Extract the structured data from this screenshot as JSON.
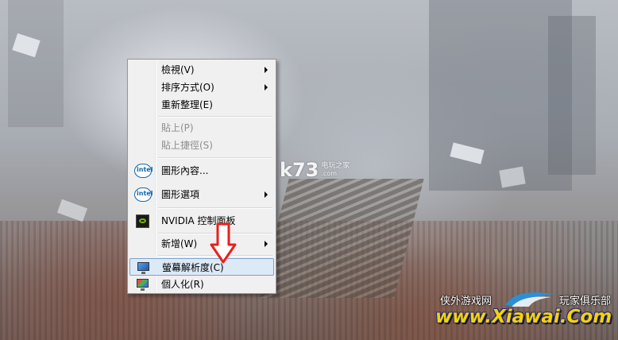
{
  "context_menu": {
    "items": [
      {
        "label": "檢視(V)",
        "submenu": true
      },
      {
        "label": "排序方式(O)",
        "submenu": true
      },
      {
        "label": "重新整理(E)"
      },
      {
        "label": "貼上(P)",
        "disabled": true
      },
      {
        "label": "貼上捷徑(S)",
        "disabled": true
      },
      {
        "label": "圖形內容...",
        "icon": "intel-icon"
      },
      {
        "label": "圖形選項",
        "icon": "intel-icon",
        "submenu": true
      },
      {
        "label": "NVIDIA 控制面板",
        "icon": "nvidia-icon"
      },
      {
        "label": "新增(W)",
        "submenu": true
      },
      {
        "label": "螢幕解析度(C)",
        "icon": "display-icon",
        "highlighted": true
      },
      {
        "label": "個人化(R)",
        "icon": "personalize-icon"
      }
    ]
  },
  "icons": {
    "intel": "intel"
  },
  "watermarks": {
    "k73_main": "k73",
    "k73_cn": "电玩之家",
    "k73_com": ".com",
    "xiawai_left": "侠外游戏网",
    "xiawai_right": "玩家俱乐部",
    "xiawai_url": "www.Xiawai.Com"
  },
  "colors": {
    "menu_bg": "#f0f0f0",
    "highlight_bg": "#dce9f6",
    "highlight_border": "#7da2ce",
    "arrow_red": "#e8201c"
  }
}
